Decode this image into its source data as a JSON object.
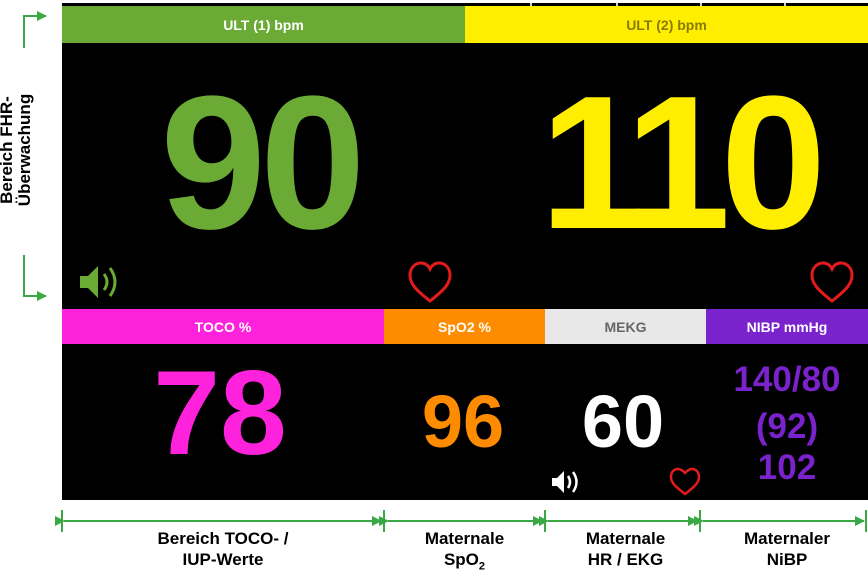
{
  "top_bars": {
    "ult1_label": "ULT (1) bpm",
    "ult2_label": "ULT (2) bpm"
  },
  "fhr": {
    "ult1_value": "90",
    "ult2_value": "110"
  },
  "bottom_bars": {
    "toco_label": "TOCO %",
    "spo2_label": "SpO2 %",
    "mekg_label": "MEKG",
    "nibp_label": "NIBP mmHg"
  },
  "values": {
    "toco": "78",
    "spo2": "96",
    "mekg": "60",
    "nibp_line1": "140/80",
    "nibp_line2": "(92)",
    "nibp_line3": "102"
  },
  "annotations": {
    "fhr_area_line1": "Bereich FHR-",
    "fhr_area_line2": "Überwachung",
    "toco_area_line1": "Bereich TOCO- /",
    "toco_area_line2": "IUP-Werte",
    "spo2_line1": "Maternale",
    "spo2_line2_main": "SpO",
    "spo2_line2_sub": "2",
    "hr_line1": "Maternale",
    "hr_line2": "HR / EKG",
    "nibp_line1": "Maternaler",
    "nibp_line2": "NiBP"
  },
  "colors": {
    "ult1": "#6aaa35",
    "ult2": "#ffee00",
    "toco": "#ff22dd",
    "spo2": "#ff8c00",
    "mekg_bar": "#e8e8e8",
    "mekg_value": "#ffffff",
    "nibp": "#7a22cc",
    "heart": "#e21b1b",
    "arrow": "#3aa845"
  }
}
